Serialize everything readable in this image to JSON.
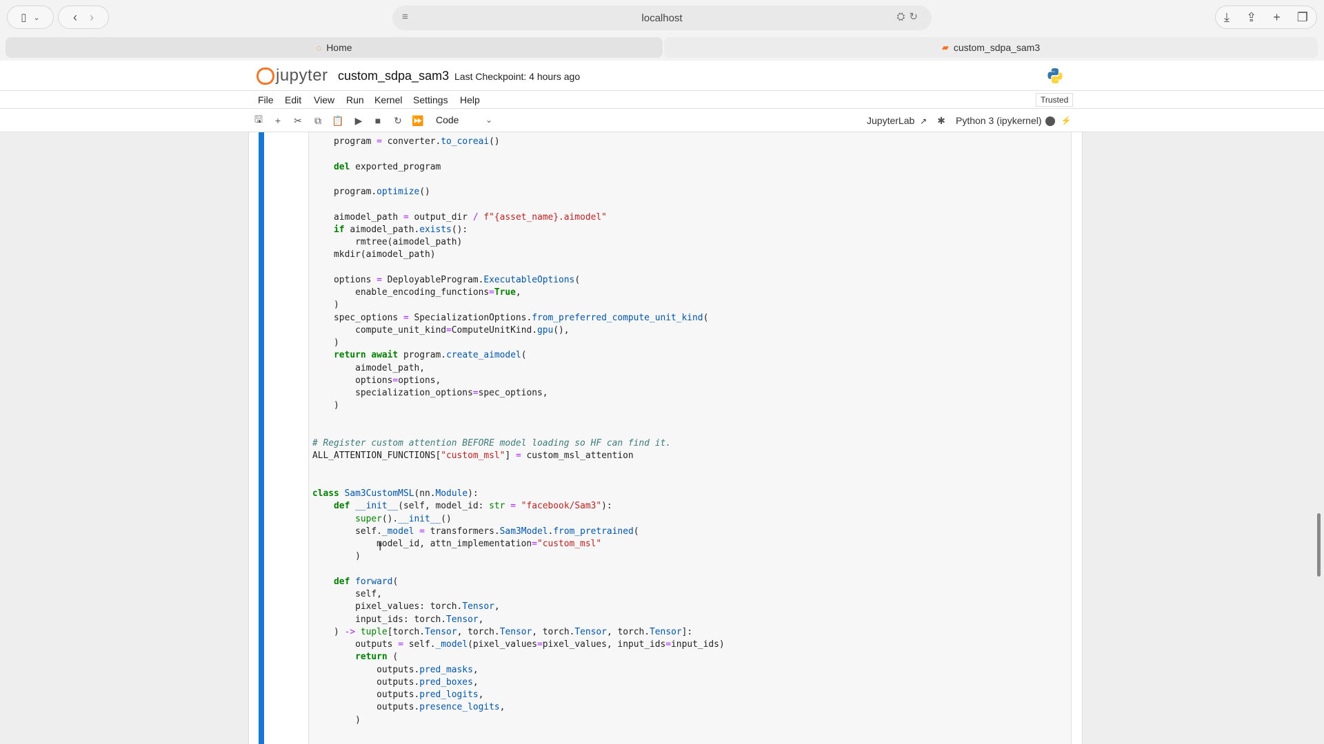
{
  "browser": {
    "address": "localhost",
    "tabs": [
      {
        "label": "Home"
      },
      {
        "label": "custom_sdpa_sam3"
      }
    ]
  },
  "jupyter": {
    "logo_text": "jupyter",
    "notebook_name": "custom_sdpa_sam3",
    "checkpoint": "Last Checkpoint: 4 hours ago",
    "menu": [
      "File",
      "Edit",
      "View",
      "Run",
      "Kernel",
      "Settings",
      "Help"
    ],
    "trusted": "Trusted",
    "cell_type": "Code",
    "jupyterlab_link": "JupyterLab",
    "kernel": "Python 3 (ipykernel)"
  },
  "code_lines": [
    "    program = converter.to_coreai()",
    "",
    "    del exported_program",
    "",
    "    program.optimize()",
    "",
    "    aimodel_path = output_dir / f\"{asset_name}.aimodel\"",
    "    if aimodel_path.exists():",
    "        rmtree(aimodel_path)",
    "    mkdir(aimodel_path)",
    "",
    "    options = DeployableProgram.ExecutableOptions(",
    "        enable_encoding_functions=True,",
    "    )",
    "    spec_options = SpecializationOptions.from_preferred_compute_unit_kind(",
    "        compute_unit_kind=ComputeUnitKind.gpu(),",
    "    )",
    "    return await program.create_aimodel(",
    "        aimodel_path,",
    "        options=options,",
    "        specialization_options=spec_options,",
    "    )",
    "",
    "",
    "# Register custom attention BEFORE model loading so HF can find it.",
    "ALL_ATTENTION_FUNCTIONS[\"custom_msl\"] = custom_msl_attention",
    "",
    "",
    "class Sam3CustomMSL(nn.Module):",
    "    def __init__(self, model_id: str = \"facebook/Sam3\"):",
    "        super().__init__()",
    "        self._model = transformers.Sam3Model.from_pretrained(",
    "            model_id, attn_implementation=\"custom_msl\"",
    "        )",
    "",
    "    def forward(",
    "        self,",
    "        pixel_values: torch.Tensor,",
    "        input_ids: torch.Tensor,",
    "    ) -> tuple[torch.Tensor, torch.Tensor, torch.Tensor, torch.Tensor]:",
    "        outputs = self._model(pixel_values=pixel_values, input_ids=input_ids)",
    "        return (",
    "            outputs.pred_masks,",
    "            outputs.pred_boxes,",
    "            outputs.pred_logits,",
    "            outputs.presence_logits,",
    "        )"
  ],
  "colors": {
    "cell_bar": "#1976d2",
    "jupyter_orange": "#f37626"
  }
}
